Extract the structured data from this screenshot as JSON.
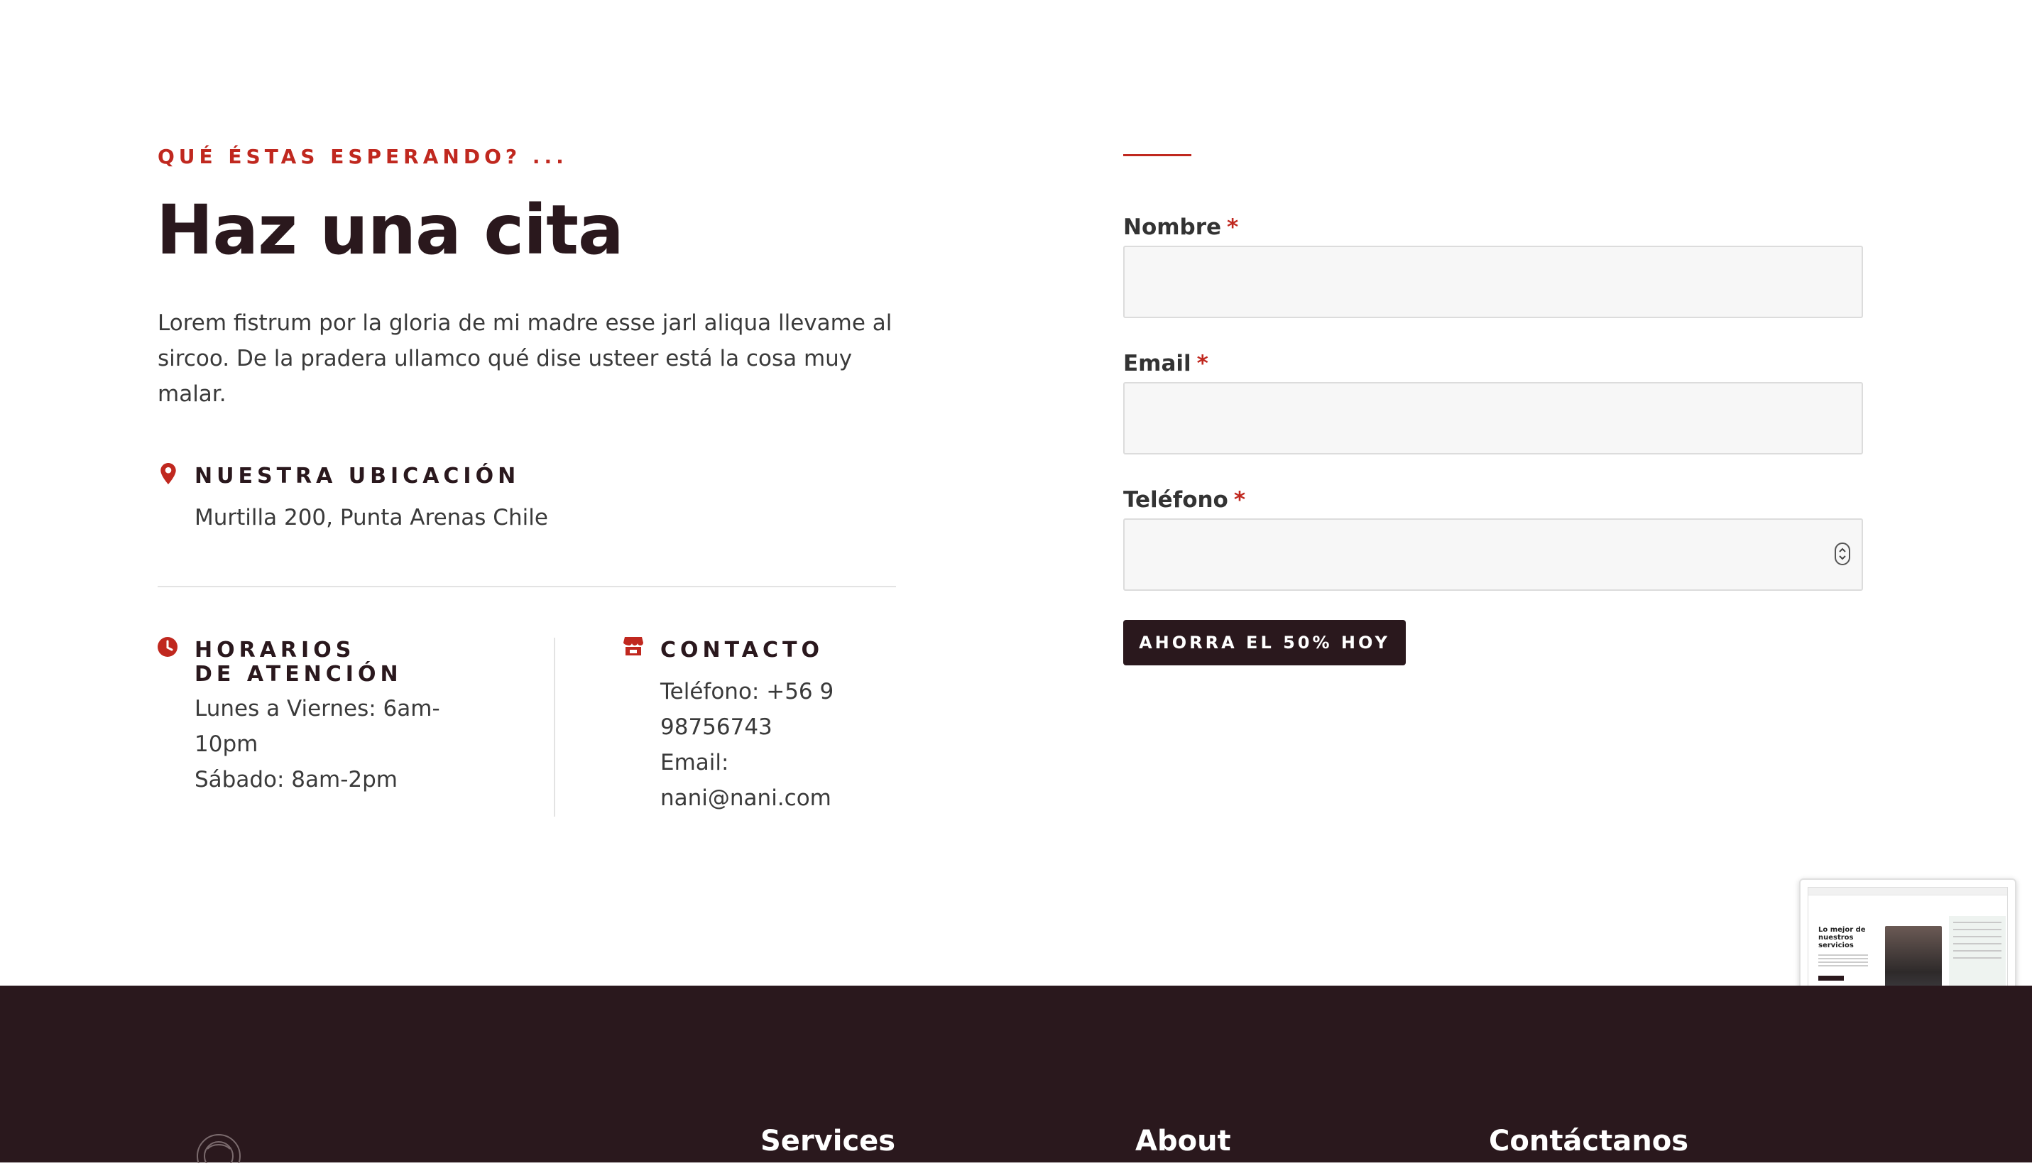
{
  "section": {
    "eyebrow": "QUÉ ÉSTAS ESPERANDO? ...",
    "title": "Haz una cita",
    "description": "Lorem fistrum por la gloria de mi madre esse jarl aliqua llevame al sircoo. De la pradera ullamco qué dise usteer está la cosa muy malar."
  },
  "location": {
    "icon": "map-pin-icon",
    "heading": "NUESTRA UBICACIÓN",
    "address": "Murtilla 200, Punta Arenas Chile"
  },
  "hours": {
    "icon": "clock-icon",
    "heading": "HORARIOS DE ATENCIÓN",
    "weekdays": "Lunes a Viernes: 6am-10pm",
    "saturday": "Sábado: 8am-2pm"
  },
  "contact": {
    "icon": "store-icon",
    "heading": "CONTACTO",
    "phone": "Teléfono: +56 9 98756743",
    "email_label": "Email:",
    "email": "nani@nani.com"
  },
  "form": {
    "fields": [
      {
        "label": "Nombre",
        "required_mark": "*",
        "value": ""
      },
      {
        "label": "Email",
        "required_mark": "*",
        "value": ""
      },
      {
        "label": "Teléfono",
        "required_mark": "*",
        "value": ""
      }
    ],
    "submit_label": "AHORRA EL 50% HOY"
  },
  "preview_thumbnail": {
    "title": "Lo mejor de nuestros servicios"
  },
  "footer": {
    "columns": [
      "Services",
      "About",
      "Contáctanos"
    ]
  },
  "colors": {
    "accent": "#c0281f",
    "dark": "#2a181d",
    "field_bg": "#f7f7f7"
  }
}
